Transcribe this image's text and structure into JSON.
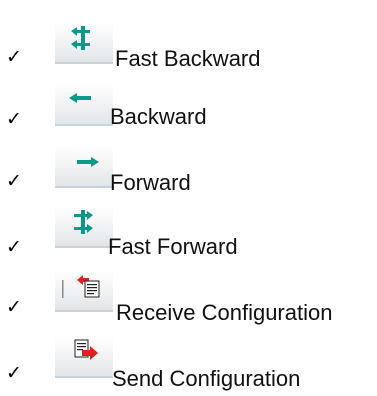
{
  "items": [
    {
      "check": "✓",
      "label": "Fast Backward",
      "icon": "fast-backward-icon"
    },
    {
      "check": "✓",
      "label": "Backward",
      "icon": "backward-icon"
    },
    {
      "check": "✓",
      "label": "Forward",
      "icon": "forward-icon"
    },
    {
      "check": "✓",
      "label": "Fast Forward",
      "icon": "fast-forward-icon"
    },
    {
      "check": "✓",
      "label": "Receive Configuration",
      "icon": "receive-configuration-icon"
    },
    {
      "check": "✓",
      "label": "Send Configuration",
      "icon": "send-configuration-icon"
    }
  ],
  "colors": {
    "arrow": "#0a9a8c",
    "red_arrow": "#e02020"
  }
}
